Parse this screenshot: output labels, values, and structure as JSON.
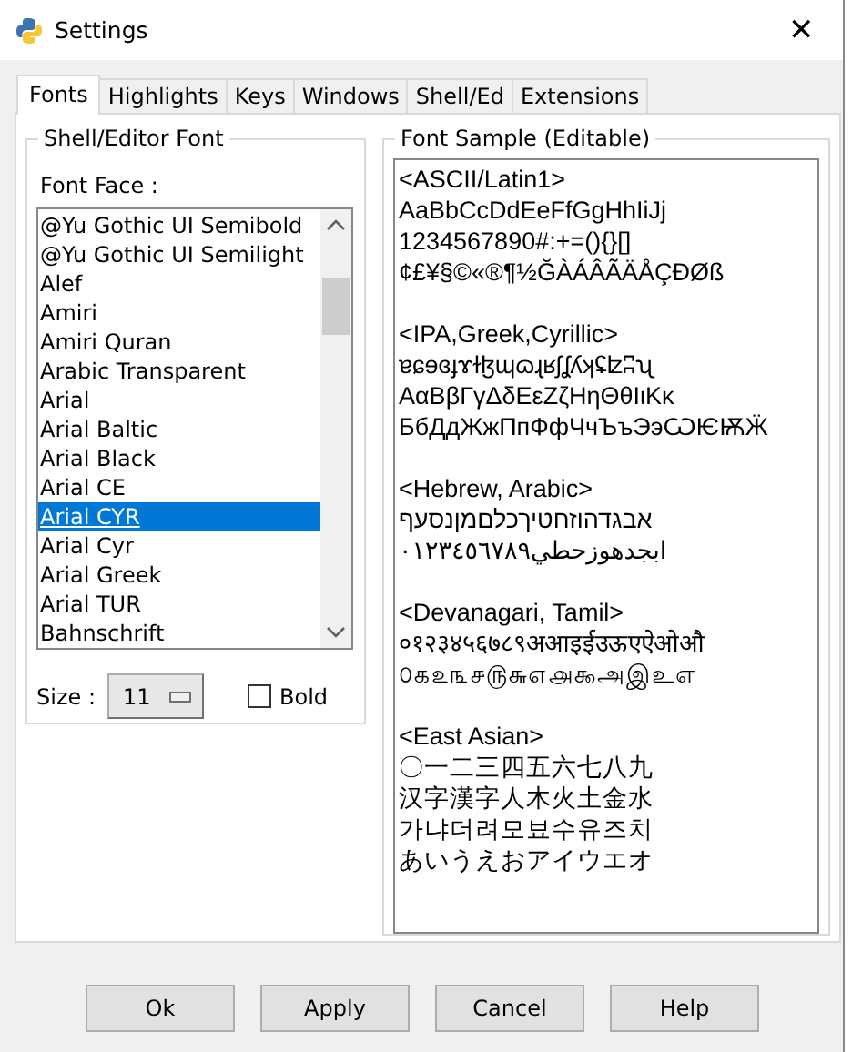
{
  "window": {
    "title": "Settings",
    "close": "✕"
  },
  "tabs": [
    {
      "label": "Fonts",
      "selected": true
    },
    {
      "label": "Highlights",
      "selected": false
    },
    {
      "label": "Keys",
      "selected": false
    },
    {
      "label": "Windows",
      "selected": false
    },
    {
      "label": "Shell/Ed",
      "selected": false
    },
    {
      "label": "Extensions",
      "selected": false
    }
  ],
  "font_group": {
    "title": "Shell/Editor Font",
    "face_label": "Font Face :",
    "fonts": [
      {
        "name": "@Yu Gothic UI Semibold",
        "selected": false
      },
      {
        "name": "@Yu Gothic UI Semilight",
        "selected": false
      },
      {
        "name": "Alef",
        "selected": false
      },
      {
        "name": "Amiri",
        "selected": false
      },
      {
        "name": "Amiri Quran",
        "selected": false
      },
      {
        "name": "Arabic Transparent",
        "selected": false
      },
      {
        "name": "Arial",
        "selected": false
      },
      {
        "name": "Arial Baltic",
        "selected": false
      },
      {
        "name": "Arial Black",
        "selected": false
      },
      {
        "name": "Arial CE",
        "selected": false
      },
      {
        "name": "Arial CYR",
        "selected": true
      },
      {
        "name": "Arial Cyr",
        "selected": false
      },
      {
        "name": "Arial Greek",
        "selected": false
      },
      {
        "name": "Arial TUR",
        "selected": false
      },
      {
        "name": "Bahnschrift",
        "selected": false
      }
    ],
    "size_label": "Size :",
    "size": "11",
    "bold": {
      "label": "Bold",
      "checked": false
    }
  },
  "sample_group": {
    "title": "Font Sample (Editable)",
    "sections": [
      {
        "heading": "<ASCII/Latin1>",
        "lines": [
          "AaBbCcDdEeFfGgHhIiJj",
          "1234567890#:+=(){}[]",
          "¢£¥§©«®¶½ĞÀÁÂÃÄÅÇÐØß"
        ]
      },
      {
        "heading": "<IPA,Greek,Cyrillic>",
        "lines": [
          "ɐɕɘɞɟɤɫɮɰɷɻʁʃʆʎʞʢʫʭʯ",
          "ΑαΒβΓγΔδΕεΖζΗηΘθΙιΚκ",
          "БбДдЖжПпФфЧчЪъЭэѠѤѬӜ"
        ]
      },
      {
        "heading": "<Hebrew, Arabic>",
        "lines": [
          "אבגדהוזחטיךכלםמןנסעף",
          "ابجدهوزحطي٠١٢٣٤٥٦٧٨٩"
        ]
      },
      {
        "heading": "<Devanagari, Tamil>",
        "lines": [
          "०१२३४५६७८९अआइईउऊएऐओऔ",
          "௦௧௨௩௪௫௬௭௮௯அஇஉஎ"
        ]
      },
      {
        "heading": "<East Asian>",
        "lines": [
          "〇一二三四五六七八九",
          "汉字漢字人木火土金水",
          "가냐더려모뵤수유즈치",
          "あいうえおアイウエオ"
        ]
      }
    ]
  },
  "buttons": [
    "Ok",
    "Apply",
    "Cancel",
    "Help"
  ]
}
